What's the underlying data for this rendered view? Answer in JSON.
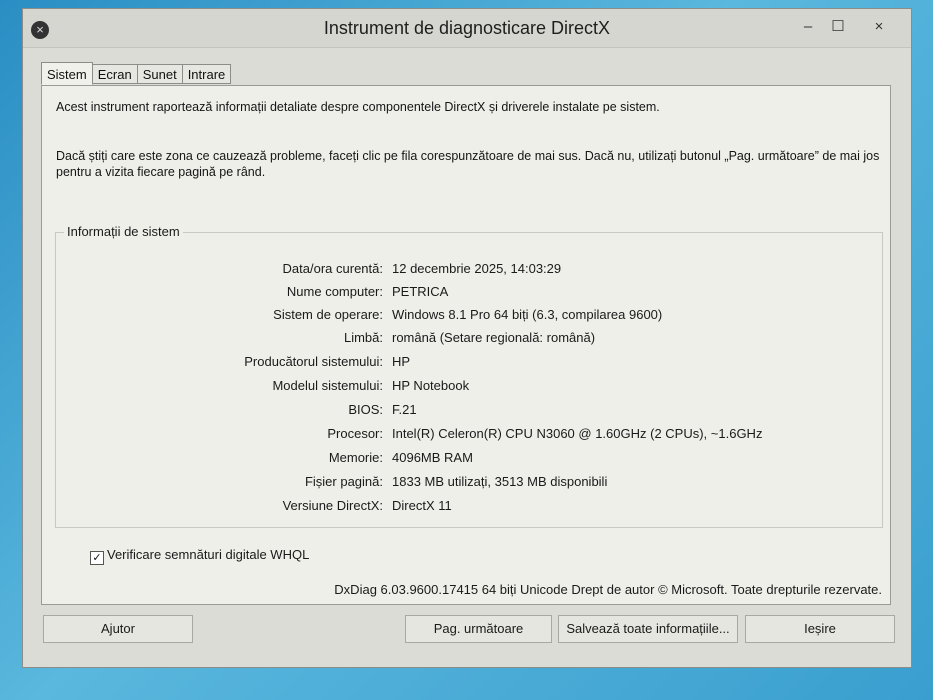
{
  "window": {
    "title": "Instrument de diagnosticare DirectX",
    "icon": "close-circle-icon",
    "controls": {
      "minimize": "–",
      "maximize": "☐",
      "close": "×"
    }
  },
  "tabs": [
    {
      "label": "Sistem",
      "active": true
    },
    {
      "label": "Ecran",
      "active": false
    },
    {
      "label": "Sunet",
      "active": false
    },
    {
      "label": "Intrare",
      "active": false
    }
  ],
  "panel": {
    "intro": "Acest instrument raportează informații detaliate despre componentele DirectX și driverele instalate pe sistem.",
    "intro2": "Dacă știți care este zona ce cauzează probleme, faceți clic pe fila corespunzătoare de mai sus. Dacă nu, utilizați butonul „Pag. următoare” de mai jos pentru a vizita fiecare pagină pe rând."
  },
  "system_info": {
    "title": "Informații de sistem",
    "rows": [
      {
        "label": "Data/ora curentă:",
        "value": "12 decembrie 2025, 14:03:29"
      },
      {
        "label": "Nume computer:",
        "value": "PETRICA"
      },
      {
        "label": "Sistem de operare:",
        "value": "Windows 8.1 Pro 64 biți (6.3, compilarea 9600)"
      },
      {
        "label": "Limbă:",
        "value": "română (Setare regională: română)"
      },
      {
        "label": "Producătorul sistemului:",
        "value": "HP"
      },
      {
        "label": "Modelul sistemului:",
        "value": "HP Notebook"
      },
      {
        "label": "BIOS:",
        "value": "F.21"
      },
      {
        "label": "Procesor:",
        "value": "Intel(R) Celeron(R) CPU  N3060  @ 1.60GHz (2 CPUs), ~1.6GHz"
      },
      {
        "label": "Memorie:",
        "value": "4096MB RAM"
      },
      {
        "label": "Fișier pagină:",
        "value": "1833 MB utilizați, 3513 MB disponibili"
      },
      {
        "label": "Versiune DirectX:",
        "value": "DirectX 11"
      }
    ]
  },
  "whql": {
    "label": "Verificare semnături digitale WHQL",
    "checked": true,
    "check_glyph": "✓"
  },
  "footer": "DxDiag 6.03.9600.17415 64 biți Unicode  Drept de autor © Microsoft. Toate drepturile rezervate.",
  "buttons": {
    "help": "Ajutor",
    "next": "Pag. următoare",
    "save": "Salvează toate informațiile...",
    "exit": "Ieșire"
  }
}
